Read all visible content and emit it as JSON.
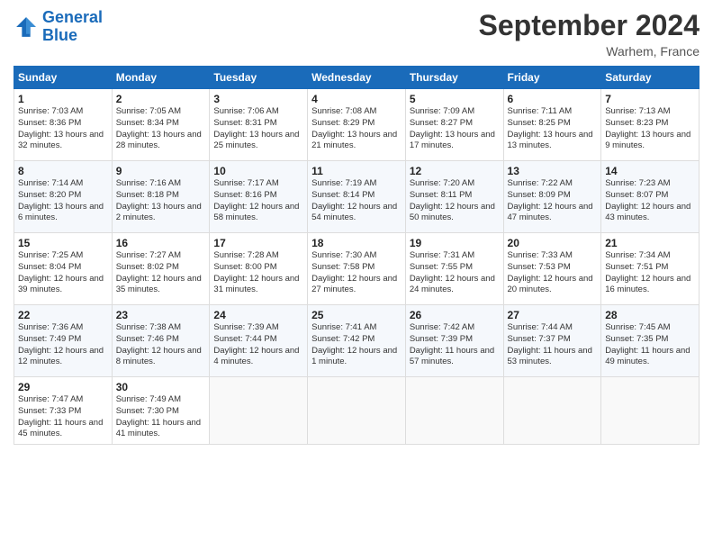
{
  "logo": {
    "line1": "General",
    "line2": "Blue"
  },
  "title": "September 2024",
  "location": "Warhem, France",
  "headers": [
    "Sunday",
    "Monday",
    "Tuesday",
    "Wednesday",
    "Thursday",
    "Friday",
    "Saturday"
  ],
  "weeks": [
    [
      {
        "day": "1",
        "sunrise": "Sunrise: 7:03 AM",
        "sunset": "Sunset: 8:36 PM",
        "daylight": "Daylight: 13 hours and 32 minutes."
      },
      {
        "day": "2",
        "sunrise": "Sunrise: 7:05 AM",
        "sunset": "Sunset: 8:34 PM",
        "daylight": "Daylight: 13 hours and 28 minutes."
      },
      {
        "day": "3",
        "sunrise": "Sunrise: 7:06 AM",
        "sunset": "Sunset: 8:31 PM",
        "daylight": "Daylight: 13 hours and 25 minutes."
      },
      {
        "day": "4",
        "sunrise": "Sunrise: 7:08 AM",
        "sunset": "Sunset: 8:29 PM",
        "daylight": "Daylight: 13 hours and 21 minutes."
      },
      {
        "day": "5",
        "sunrise": "Sunrise: 7:09 AM",
        "sunset": "Sunset: 8:27 PM",
        "daylight": "Daylight: 13 hours and 17 minutes."
      },
      {
        "day": "6",
        "sunrise": "Sunrise: 7:11 AM",
        "sunset": "Sunset: 8:25 PM",
        "daylight": "Daylight: 13 hours and 13 minutes."
      },
      {
        "day": "7",
        "sunrise": "Sunrise: 7:13 AM",
        "sunset": "Sunset: 8:23 PM",
        "daylight": "Daylight: 13 hours and 9 minutes."
      }
    ],
    [
      {
        "day": "8",
        "sunrise": "Sunrise: 7:14 AM",
        "sunset": "Sunset: 8:20 PM",
        "daylight": "Daylight: 13 hours and 6 minutes."
      },
      {
        "day": "9",
        "sunrise": "Sunrise: 7:16 AM",
        "sunset": "Sunset: 8:18 PM",
        "daylight": "Daylight: 13 hours and 2 minutes."
      },
      {
        "day": "10",
        "sunrise": "Sunrise: 7:17 AM",
        "sunset": "Sunset: 8:16 PM",
        "daylight": "Daylight: 12 hours and 58 minutes."
      },
      {
        "day": "11",
        "sunrise": "Sunrise: 7:19 AM",
        "sunset": "Sunset: 8:14 PM",
        "daylight": "Daylight: 12 hours and 54 minutes."
      },
      {
        "day": "12",
        "sunrise": "Sunrise: 7:20 AM",
        "sunset": "Sunset: 8:11 PM",
        "daylight": "Daylight: 12 hours and 50 minutes."
      },
      {
        "day": "13",
        "sunrise": "Sunrise: 7:22 AM",
        "sunset": "Sunset: 8:09 PM",
        "daylight": "Daylight: 12 hours and 47 minutes."
      },
      {
        "day": "14",
        "sunrise": "Sunrise: 7:23 AM",
        "sunset": "Sunset: 8:07 PM",
        "daylight": "Daylight: 12 hours and 43 minutes."
      }
    ],
    [
      {
        "day": "15",
        "sunrise": "Sunrise: 7:25 AM",
        "sunset": "Sunset: 8:04 PM",
        "daylight": "Daylight: 12 hours and 39 minutes."
      },
      {
        "day": "16",
        "sunrise": "Sunrise: 7:27 AM",
        "sunset": "Sunset: 8:02 PM",
        "daylight": "Daylight: 12 hours and 35 minutes."
      },
      {
        "day": "17",
        "sunrise": "Sunrise: 7:28 AM",
        "sunset": "Sunset: 8:00 PM",
        "daylight": "Daylight: 12 hours and 31 minutes."
      },
      {
        "day": "18",
        "sunrise": "Sunrise: 7:30 AM",
        "sunset": "Sunset: 7:58 PM",
        "daylight": "Daylight: 12 hours and 27 minutes."
      },
      {
        "day": "19",
        "sunrise": "Sunrise: 7:31 AM",
        "sunset": "Sunset: 7:55 PM",
        "daylight": "Daylight: 12 hours and 24 minutes."
      },
      {
        "day": "20",
        "sunrise": "Sunrise: 7:33 AM",
        "sunset": "Sunset: 7:53 PM",
        "daylight": "Daylight: 12 hours and 20 minutes."
      },
      {
        "day": "21",
        "sunrise": "Sunrise: 7:34 AM",
        "sunset": "Sunset: 7:51 PM",
        "daylight": "Daylight: 12 hours and 16 minutes."
      }
    ],
    [
      {
        "day": "22",
        "sunrise": "Sunrise: 7:36 AM",
        "sunset": "Sunset: 7:49 PM",
        "daylight": "Daylight: 12 hours and 12 minutes."
      },
      {
        "day": "23",
        "sunrise": "Sunrise: 7:38 AM",
        "sunset": "Sunset: 7:46 PM",
        "daylight": "Daylight: 12 hours and 8 minutes."
      },
      {
        "day": "24",
        "sunrise": "Sunrise: 7:39 AM",
        "sunset": "Sunset: 7:44 PM",
        "daylight": "Daylight: 12 hours and 4 minutes."
      },
      {
        "day": "25",
        "sunrise": "Sunrise: 7:41 AM",
        "sunset": "Sunset: 7:42 PM",
        "daylight": "Daylight: 12 hours and 1 minute."
      },
      {
        "day": "26",
        "sunrise": "Sunrise: 7:42 AM",
        "sunset": "Sunset: 7:39 PM",
        "daylight": "Daylight: 11 hours and 57 minutes."
      },
      {
        "day": "27",
        "sunrise": "Sunrise: 7:44 AM",
        "sunset": "Sunset: 7:37 PM",
        "daylight": "Daylight: 11 hours and 53 minutes."
      },
      {
        "day": "28",
        "sunrise": "Sunrise: 7:45 AM",
        "sunset": "Sunset: 7:35 PM",
        "daylight": "Daylight: 11 hours and 49 minutes."
      }
    ],
    [
      {
        "day": "29",
        "sunrise": "Sunrise: 7:47 AM",
        "sunset": "Sunset: 7:33 PM",
        "daylight": "Daylight: 11 hours and 45 minutes."
      },
      {
        "day": "30",
        "sunrise": "Sunrise: 7:49 AM",
        "sunset": "Sunset: 7:30 PM",
        "daylight": "Daylight: 11 hours and 41 minutes."
      },
      null,
      null,
      null,
      null,
      null
    ]
  ]
}
